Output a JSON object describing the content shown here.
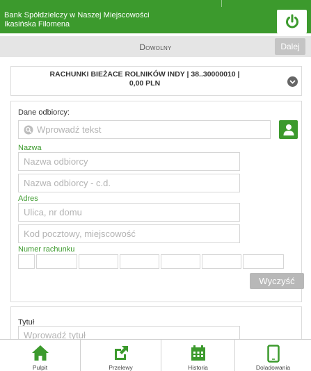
{
  "header": {
    "bank_name": "Bank Spółdzielczy w Naszej Miejscowości",
    "user_name": "Ikasińska Filomena",
    "logout_icon": "power-icon"
  },
  "subheader": {
    "mode": "Dowolny",
    "next_label": "Dalej"
  },
  "account": {
    "line1": "RACHUNKI BIEŻACE ROLNIKÓW INDY | 38..30000010 |",
    "line2": "0,00 PLN"
  },
  "recipient": {
    "label": "Dane odbiorcy:",
    "search_placeholder": "Wprowadź tekst",
    "name_label": "Nazwa",
    "name_placeholder": "Nazwa odbiorcy",
    "name2_placeholder": "Nazwa odbiorcy - c.d.",
    "address_label": "Adres",
    "street_placeholder": "Ulica, nr domu",
    "city_placeholder": "Kod pocztowy, miejscowość",
    "account_label": "Numer rachunku",
    "clear_label": "Wyczyść"
  },
  "title_section": {
    "label": "Tytuł",
    "placeholder": "Wprowadź tytuł"
  },
  "nav": {
    "pulpit": "Pulpit",
    "przelewy": "Przelewy",
    "historia": "Historia",
    "doladowania": "Doladowania"
  },
  "colors": {
    "brand": "#3c9a2d",
    "button_disabled": "#c4c4c4"
  }
}
